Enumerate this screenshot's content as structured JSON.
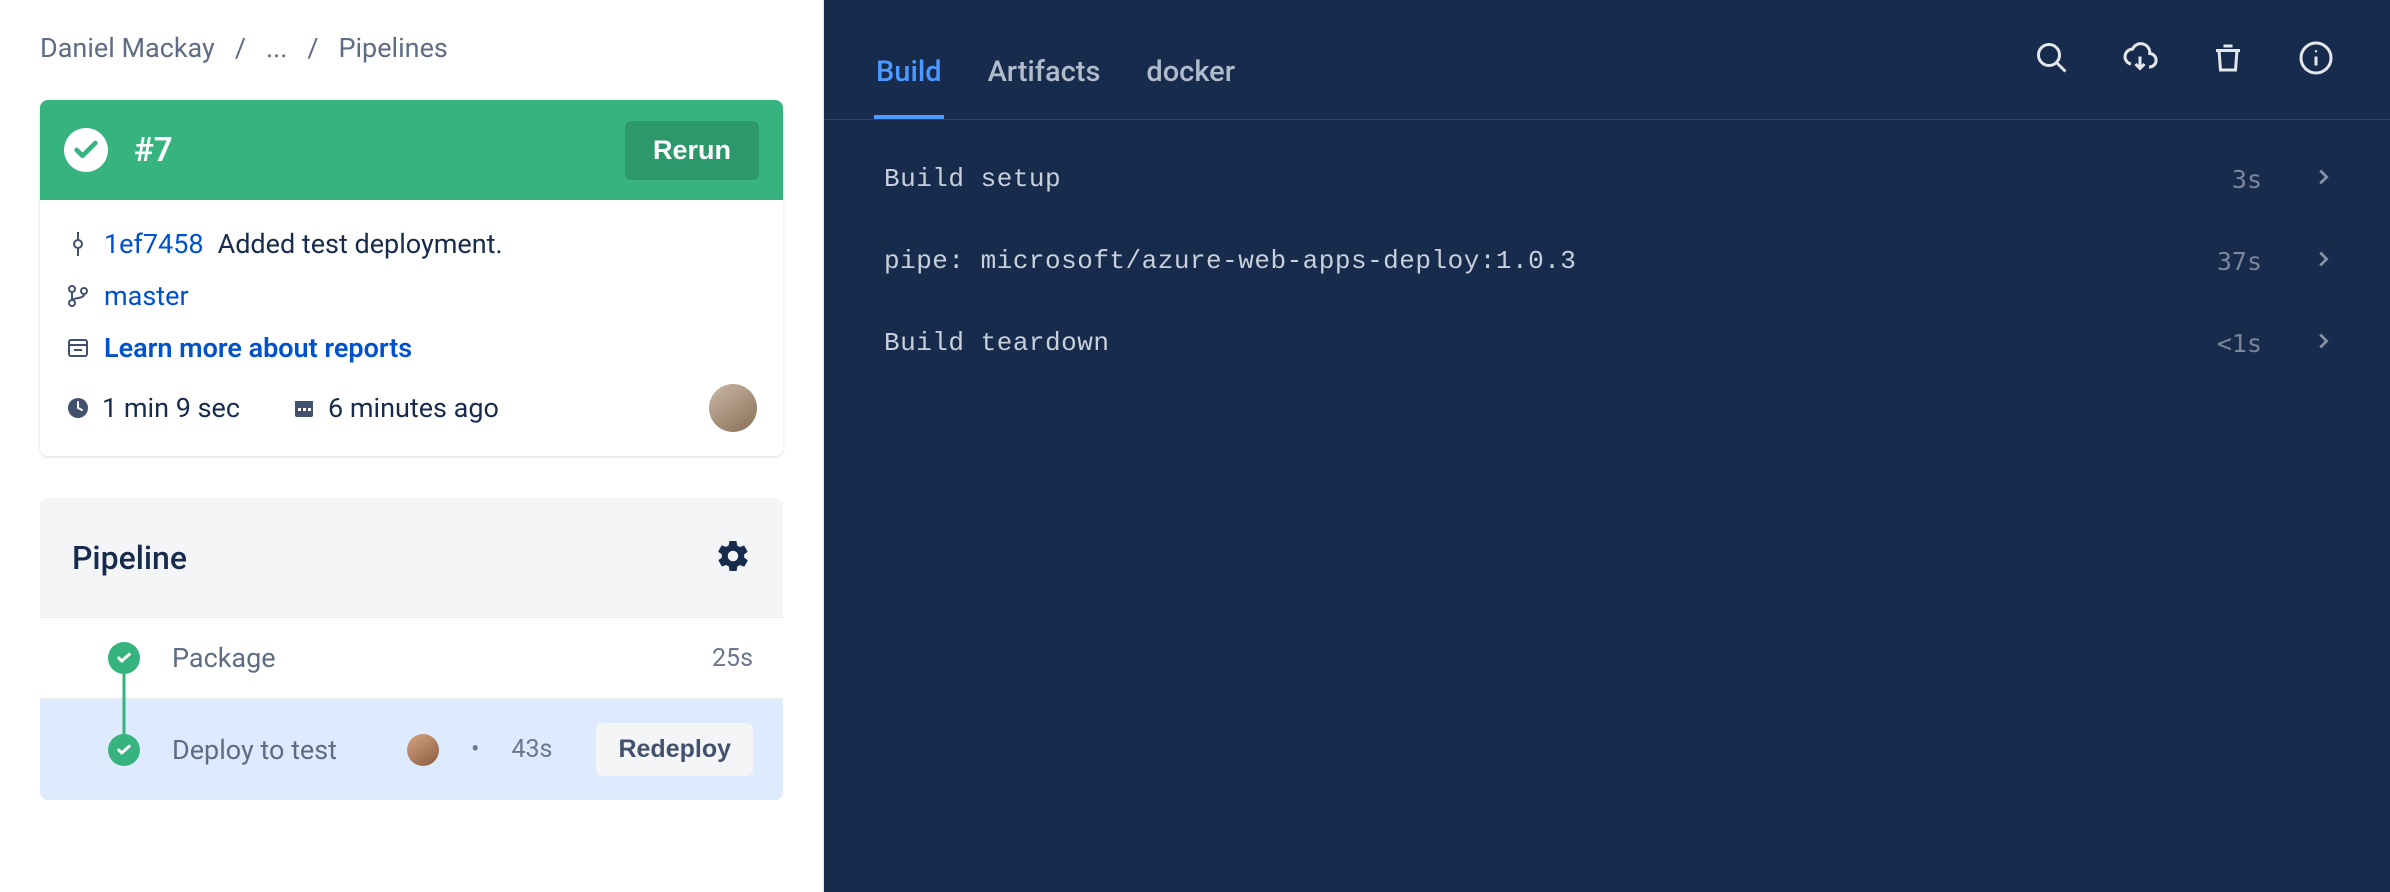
{
  "breadcrumb": {
    "owner": "Daniel Mackay",
    "sep": "/",
    "ellipsis": "...",
    "current": "Pipelines"
  },
  "run": {
    "number": "#7",
    "rerun_label": "Rerun",
    "commit_hash": "1ef7458",
    "commit_msg": "Added test deployment.",
    "branch": "master",
    "learn_more": "Learn more about reports",
    "duration": "1 min 9 sec",
    "when": "6 minutes ago"
  },
  "pipeline": {
    "title": "Pipeline",
    "steps": [
      {
        "label": "Package",
        "time": "25s",
        "selected": false,
        "has_avatar": false,
        "action": null
      },
      {
        "label": "Deploy to test",
        "time": "43s",
        "selected": true,
        "has_avatar": true,
        "action": "Redeploy"
      }
    ]
  },
  "logs": {
    "tabs": [
      {
        "label": "Build",
        "active": true
      },
      {
        "label": "Artifacts",
        "active": false
      },
      {
        "label": "docker",
        "active": false
      }
    ],
    "rows": [
      {
        "text": "Build setup",
        "time": "3s"
      },
      {
        "text": "pipe: microsoft/azure-web-apps-deploy:1.0.3",
        "time": "37s"
      },
      {
        "text": "Build teardown",
        "time": "<1s"
      }
    ]
  }
}
